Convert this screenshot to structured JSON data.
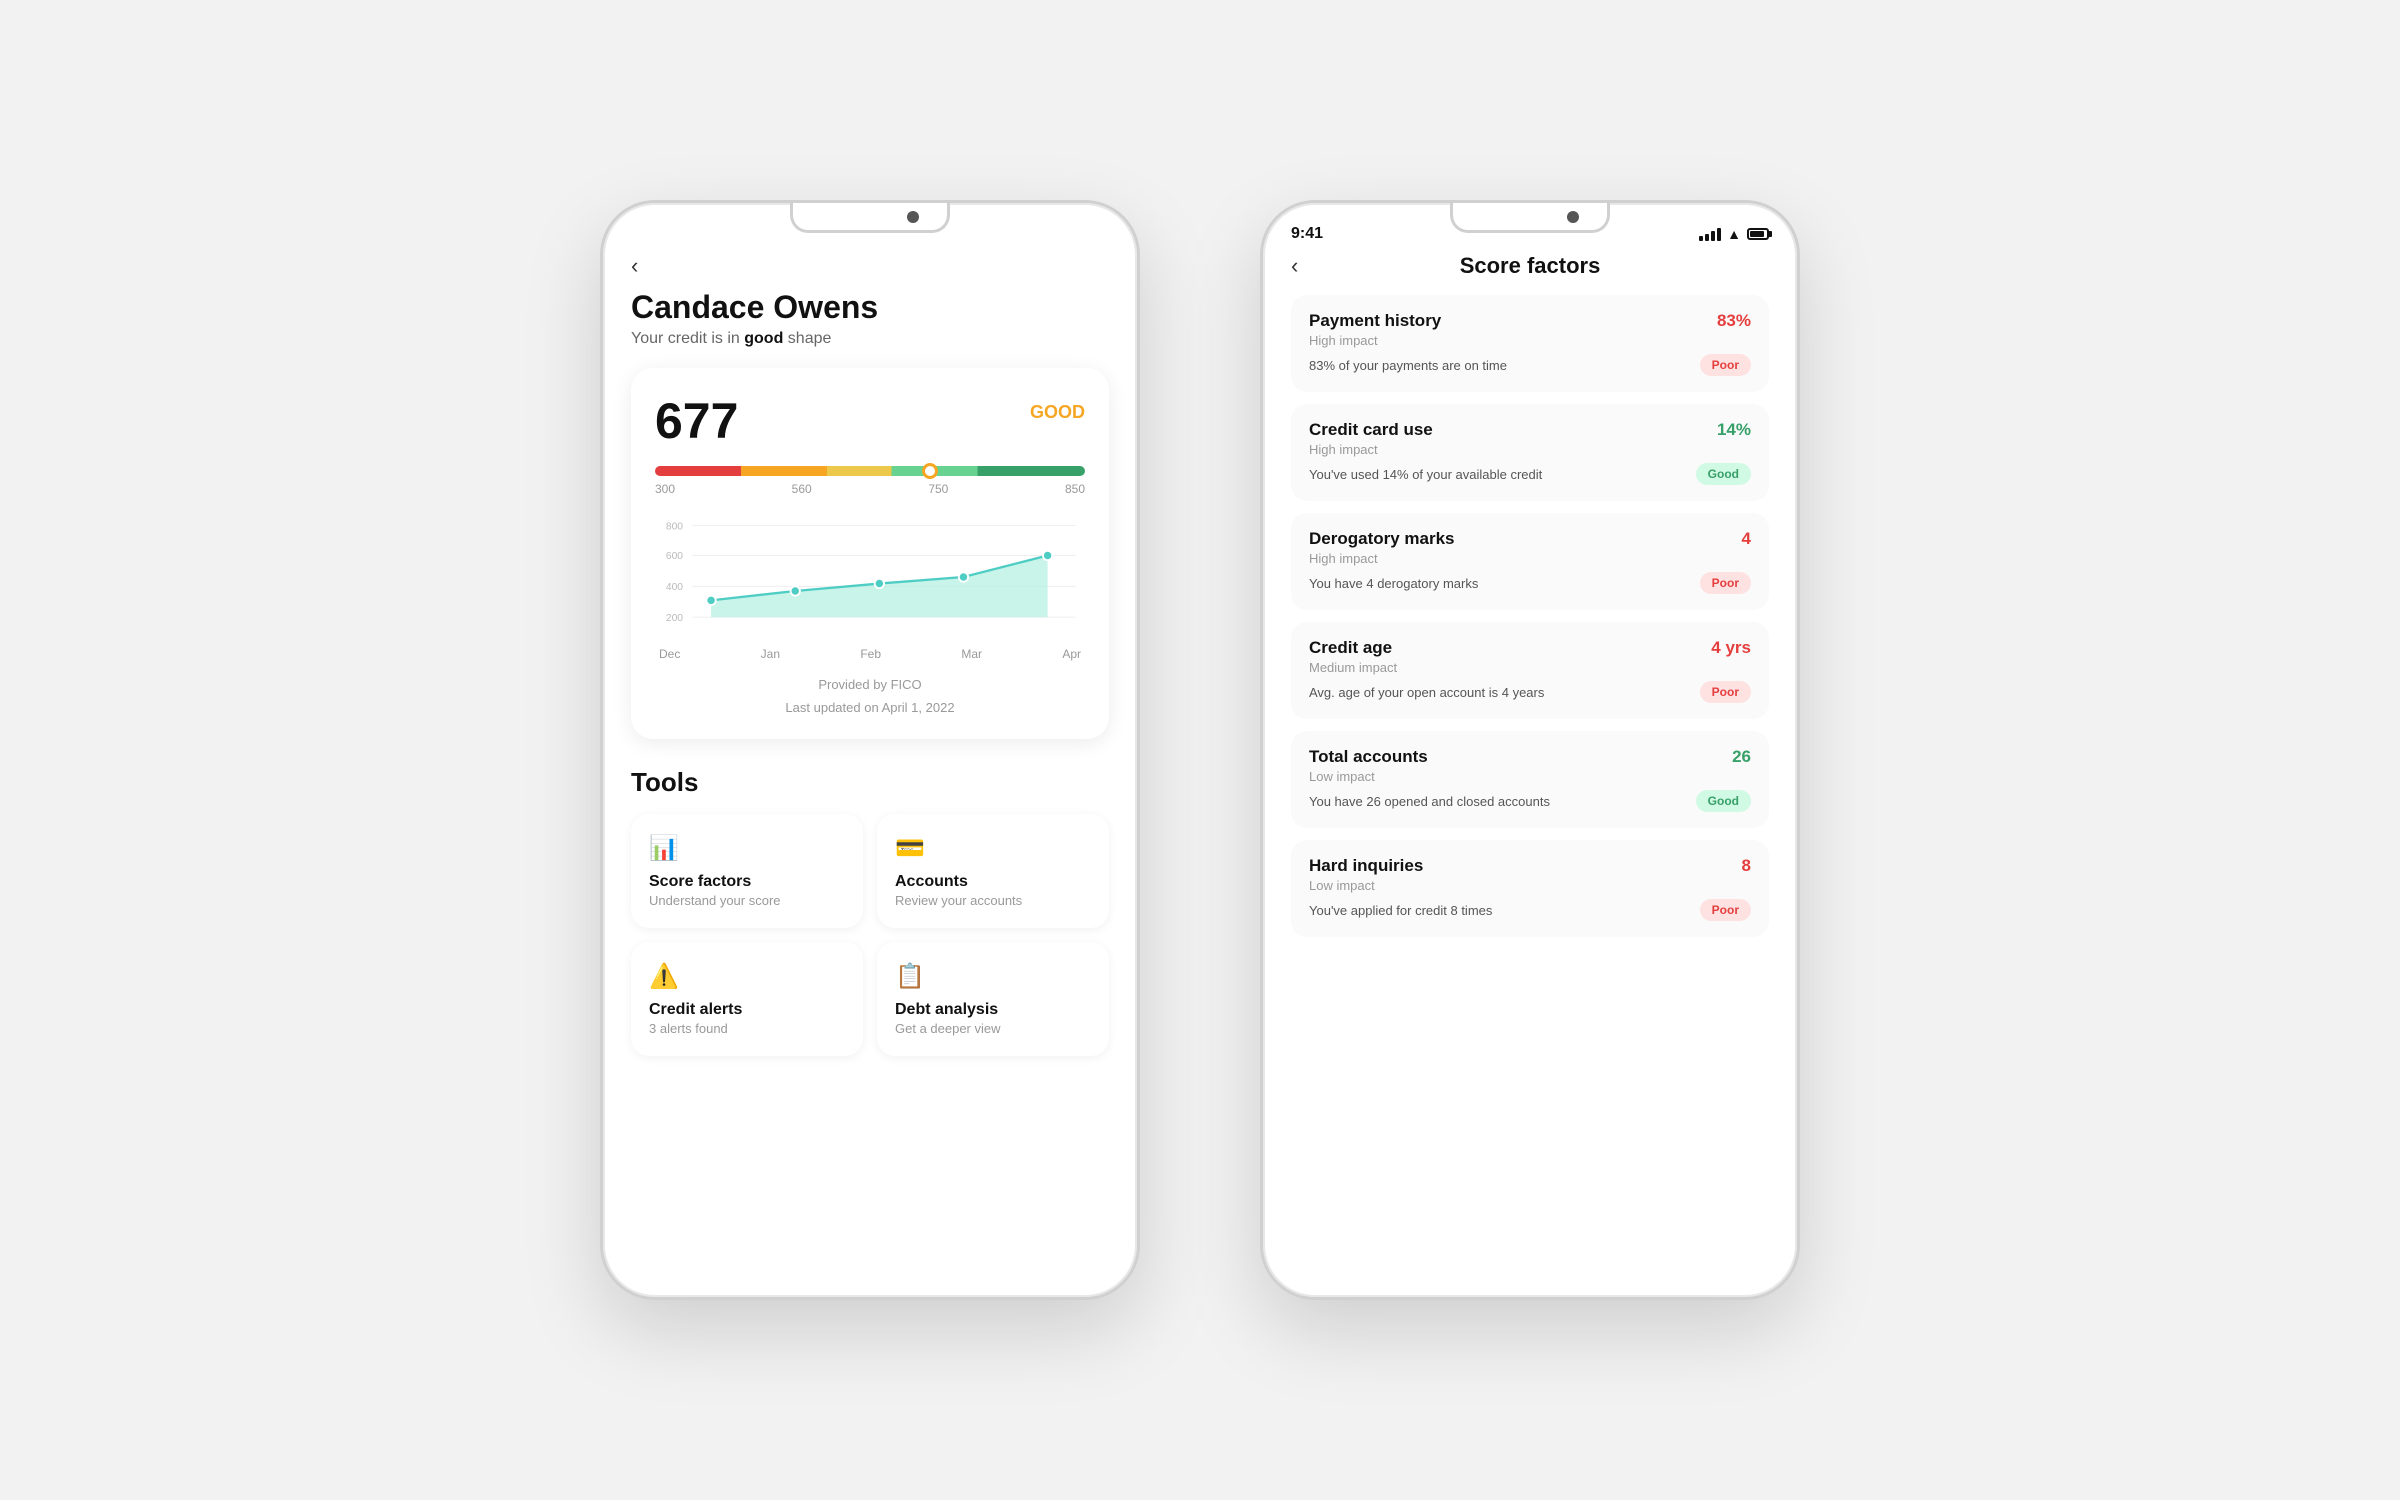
{
  "left_phone": {
    "status": "",
    "back_label": "‹",
    "user_name": "Candace Owens",
    "subtitle_prefix": "Your credit is in ",
    "subtitle_bold": "good",
    "subtitle_suffix": " shape",
    "score": "677",
    "score_rating": "GOOD",
    "gauge_labels": [
      "300",
      "560",
      "750",
      "850"
    ],
    "chart_y_labels": [
      "800",
      "600",
      "400",
      "200"
    ],
    "chart_x_labels": [
      "Dec",
      "Jan",
      "Feb",
      "Mar",
      "Apr"
    ],
    "provided_by": "Provided by FICO",
    "last_updated": "Last updated on April 1, 2022",
    "tools_title": "Tools",
    "tools": [
      {
        "icon": "📊",
        "name": "Score factors",
        "desc": "Understand your score"
      },
      {
        "icon": "💳",
        "name": "Accounts",
        "desc": "Review your accounts"
      },
      {
        "icon": "⚠",
        "name": "Credit alerts",
        "desc": "3 alerts found"
      },
      {
        "icon": "📋",
        "name": "Debt analysis",
        "desc": "Get a deeper view"
      }
    ]
  },
  "right_phone": {
    "time": "9:41",
    "back_label": "‹",
    "title": "Score factors",
    "factors": [
      {
        "name": "Payment history",
        "value": "83%",
        "value_color": "red",
        "impact": "High impact",
        "desc": "83% of your payments are on time",
        "badge": "Poor",
        "badge_type": "poor"
      },
      {
        "name": "Credit card use",
        "value": "14%",
        "value_color": "green",
        "impact": "High impact",
        "desc": "You've used 14% of your available credit",
        "badge": "Good",
        "badge_type": "good"
      },
      {
        "name": "Derogatory marks",
        "value": "4",
        "value_color": "red",
        "impact": "High impact",
        "desc": "You have 4 derogatory marks",
        "badge": "Poor",
        "badge_type": "poor"
      },
      {
        "name": "Credit age",
        "value": "4 yrs",
        "value_color": "red",
        "impact": "Medium impact",
        "desc": "Avg. age of your open account is 4 years",
        "badge": "Poor",
        "badge_type": "poor"
      },
      {
        "name": "Total accounts",
        "value": "26",
        "value_color": "green",
        "impact": "Low impact",
        "desc": "You have 26 opened and closed accounts",
        "badge": "Good",
        "badge_type": "good"
      },
      {
        "name": "Hard inquiries",
        "value": "8",
        "value_color": "red",
        "impact": "Low impact",
        "desc": "You've applied for credit 8 times",
        "badge": "Poor",
        "badge_type": "poor"
      }
    ]
  }
}
